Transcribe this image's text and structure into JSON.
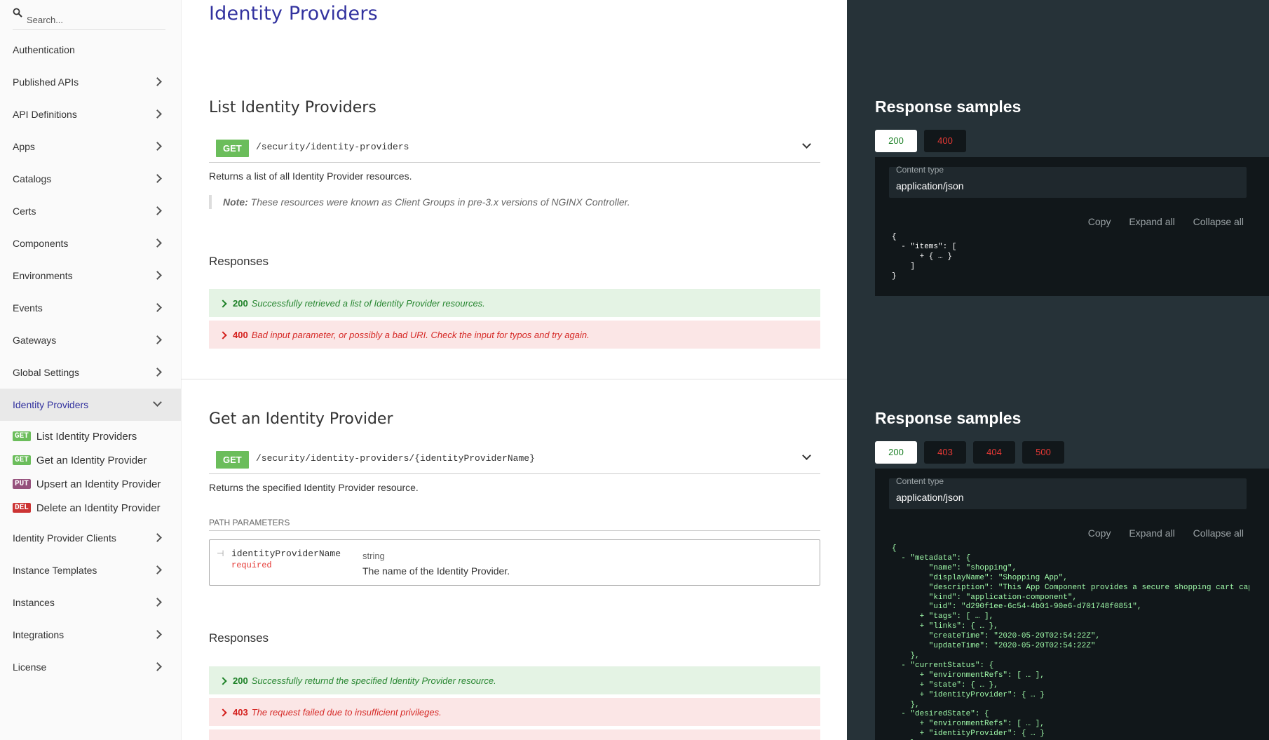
{
  "sidebar": {
    "search_placeholder": "Search...",
    "items": [
      {
        "label": "Authentication"
      },
      {
        "label": "Published APIs"
      },
      {
        "label": "API Definitions"
      },
      {
        "label": "Apps"
      },
      {
        "label": "Catalogs"
      },
      {
        "label": "Certs"
      },
      {
        "label": "Components"
      },
      {
        "label": "Environments"
      },
      {
        "label": "Events"
      },
      {
        "label": "Gateways"
      },
      {
        "label": "Global Settings"
      },
      {
        "label": "Identity Providers"
      },
      {
        "label": "Identity Provider Clients"
      },
      {
        "label": "Instance Templates"
      },
      {
        "label": "Instances"
      },
      {
        "label": "Integrations"
      },
      {
        "label": "License"
      }
    ],
    "sub_items": [
      {
        "method": "GET",
        "label": "List Identity Providers"
      },
      {
        "method": "GET",
        "label": "Get an Identity Provider"
      },
      {
        "method": "PUT",
        "label": "Upsert an Identity Provider"
      },
      {
        "method": "DEL",
        "label": "Delete an Identity Provider"
      }
    ]
  },
  "main": {
    "page_title": "Identity Providers",
    "op1": {
      "title": "List Identity Providers",
      "method": "GET",
      "path": "/security/identity-providers",
      "description": "Returns a list of all Identity Provider resources.",
      "note_label": "Note:",
      "note_text": " These resources were known as Client Groups in pre-3.x versions of NGINX Controller.",
      "responses_title": "Responses",
      "responses": [
        {
          "code": "200",
          "text": "Successfully retrieved a list of Identity Provider resources."
        },
        {
          "code": "400",
          "text": "Bad input parameter, or possibly a bad URI. Check the input for typos and try again."
        }
      ]
    },
    "op2": {
      "title": "Get an Identity Provider",
      "method": "GET",
      "path": "/security/identity-providers/{identityProviderName}",
      "description": "Returns the specified Identity Provider resource.",
      "params_label": "PATH PARAMETERS",
      "param": {
        "name": "identityProviderName",
        "required": "required",
        "type": "string",
        "description": "The name of the Identity Provider."
      },
      "responses_title": "Responses",
      "responses": [
        {
          "code": "200",
          "text": "Successfully returnd the specified Identity Provider resource."
        },
        {
          "code": "403",
          "text": "The request failed due to insufficient privileges."
        }
      ]
    }
  },
  "right": {
    "sample1": {
      "title": "Response samples",
      "tabs": [
        "200",
        "400"
      ],
      "content_type_label": "Content type",
      "content_type": "application/json",
      "actions": [
        "Copy",
        "Expand all",
        "Collapse all"
      ],
      "code": "{\n  - \"items\": [\n      + { … }\n    ]\n}"
    },
    "sample2": {
      "title": "Response samples",
      "tabs": [
        "200",
        "403",
        "404",
        "500"
      ],
      "content_type_label": "Content type",
      "content_type": "application/json",
      "actions": [
        "Copy",
        "Expand all",
        "Collapse all"
      ],
      "code": "{\n  - \"metadata\": {\n        \"name\": \"shopping\",\n        \"displayName\": \"Shopping App\",\n        \"description\": \"This App Component provides a secure shopping cart cap\n        \"kind\": \"application-component\",\n        \"uid\": \"d290f1ee-6c54-4b01-90e6-d701748f0851\",\n      + \"tags\": [ … ],\n      + \"links\": { … },\n        \"createTime\": \"2020-05-20T02:54:22Z\",\n        \"updateTime\": \"2020-05-20T02:54:22Z\"\n    },\n  - \"currentStatus\": {\n      + \"environmentRefs\": [ … ],\n      + \"state\": { … },\n      + \"identityProvider\": { … }\n    },\n  - \"desiredState\": {\n      + \"environmentRefs\": [ … ],\n      + \"identityProvider\": { … }\n    }"
    },
    "colors": {
      "panel_bg": "#263238",
      "code_bg": "#11171a",
      "success": "#1d8127",
      "error": "#d41f1c",
      "title_accent": "#32329f"
    }
  }
}
